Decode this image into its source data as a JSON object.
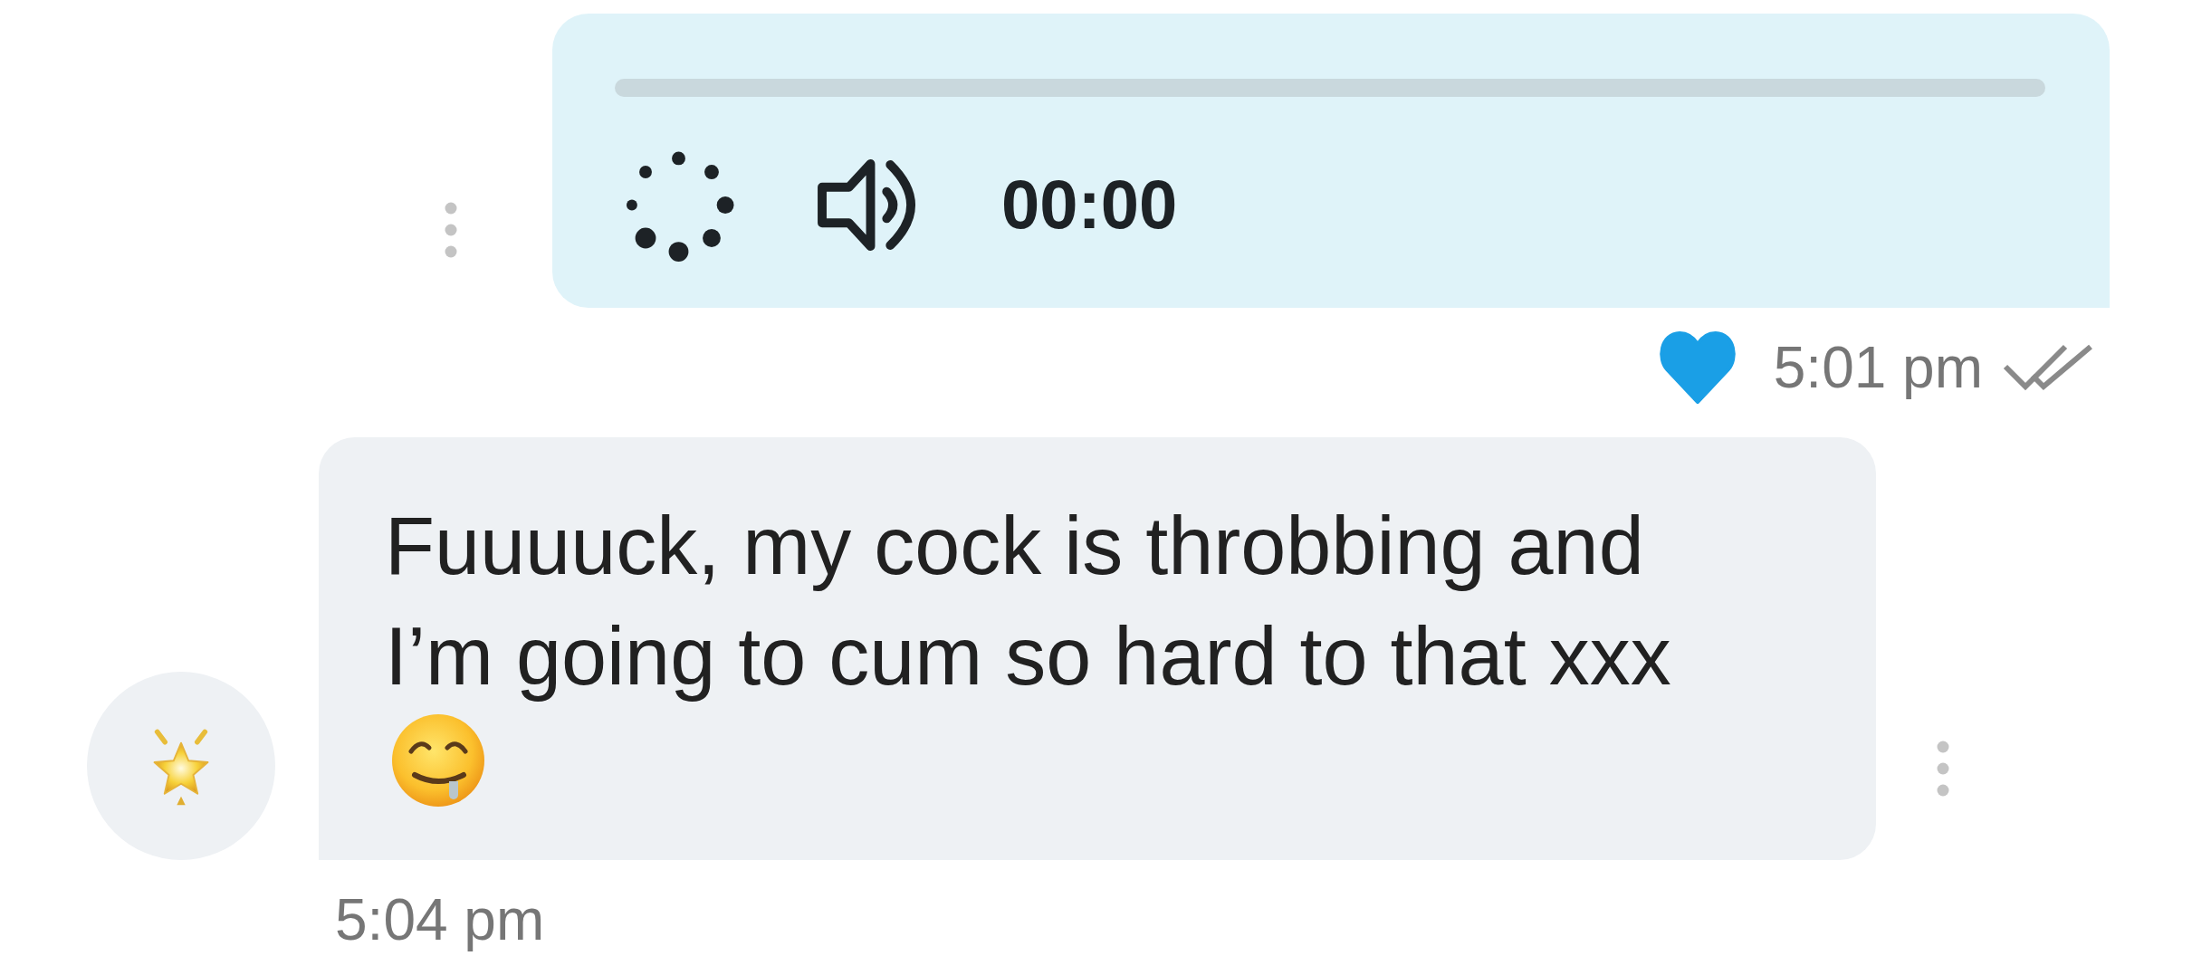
{
  "conversation": {
    "messages": [
      {
        "kind": "audio",
        "loading": true,
        "duration": "00:00",
        "liked": true,
        "time": "5:01 pm",
        "read": true
      },
      {
        "kind": "text",
        "text": "Fuuuuck, my cock is throbbing and I’m going to cum so hard to that xxx",
        "time": "5:04 pm"
      }
    ]
  }
}
